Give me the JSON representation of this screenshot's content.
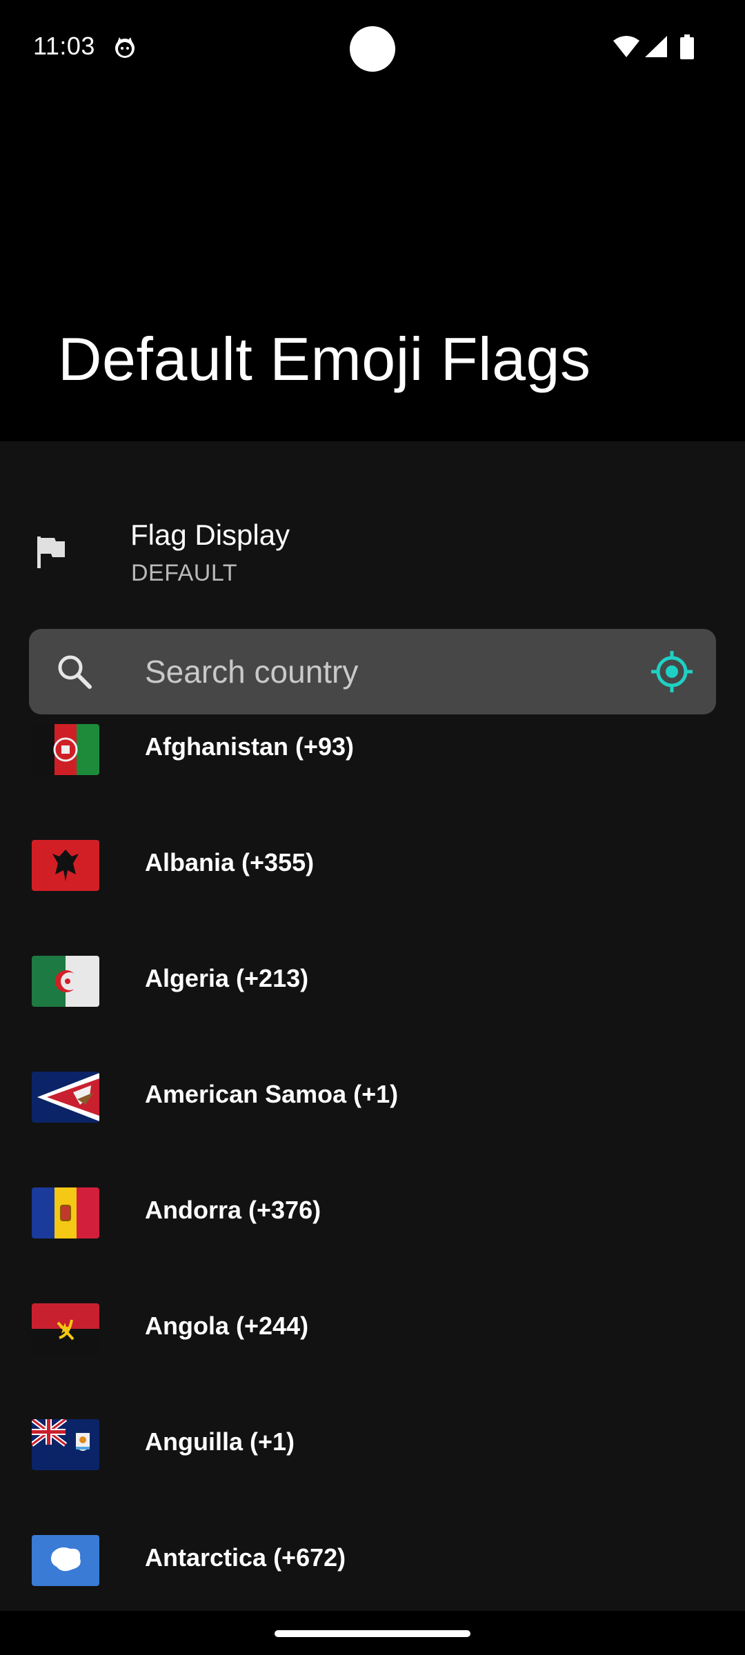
{
  "status_bar": {
    "time": "11:03",
    "icons": [
      "cat-notification-icon",
      "wifi-icon",
      "cell-signal-icon",
      "battery-icon"
    ]
  },
  "header": {
    "title": "Default Emoji Flags"
  },
  "preference": {
    "icon": "flag-icon",
    "title": "Flag Display",
    "summary": "DEFAULT"
  },
  "search": {
    "placeholder": "Search country",
    "value": "",
    "icon": "search-icon",
    "action_icon": "my-location-icon"
  },
  "countries": [
    {
      "label": "Afghanistan (+93)",
      "flag": "AF"
    },
    {
      "label": "Albania (+355)",
      "flag": "AL"
    },
    {
      "label": "Algeria (+213)",
      "flag": "DZ"
    },
    {
      "label": "American Samoa (+1)",
      "flag": "AS"
    },
    {
      "label": "Andorra (+376)",
      "flag": "AD"
    },
    {
      "label": "Angola (+244)",
      "flag": "AO"
    },
    {
      "label": "Anguilla (+1)",
      "flag": "AI"
    },
    {
      "label": "Antarctica (+672)",
      "flag": "AQ"
    }
  ],
  "colors": {
    "background": "#000000",
    "list_background": "#121212",
    "search_background": "#474747",
    "accent": "#1ed1c4"
  }
}
